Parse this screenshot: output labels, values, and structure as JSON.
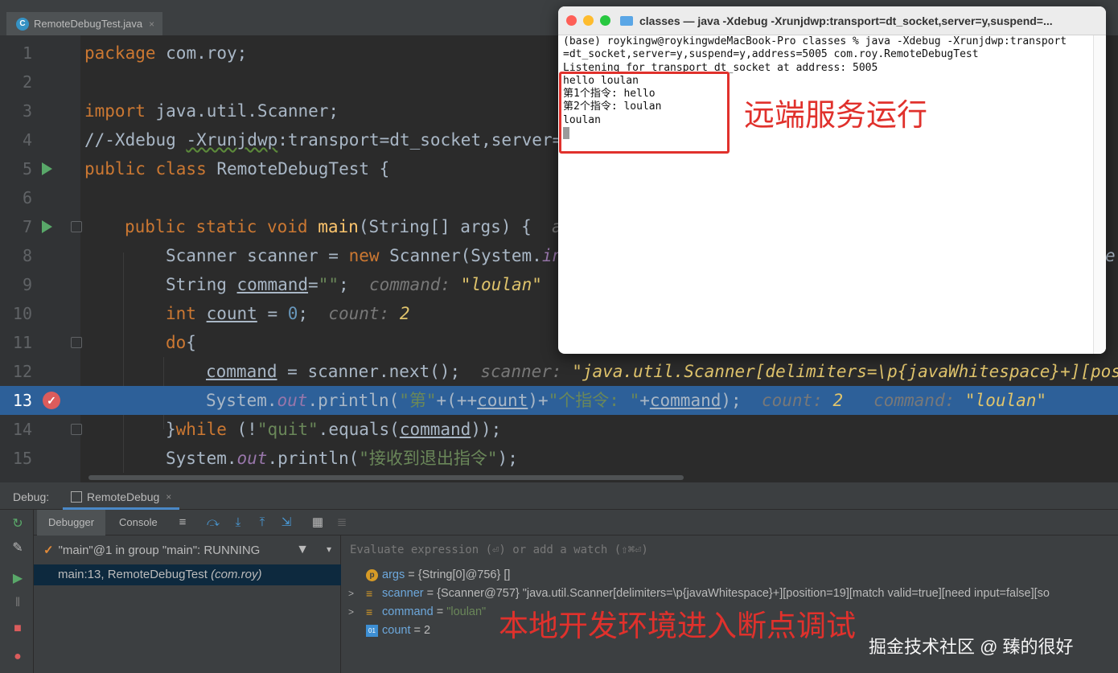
{
  "editor_tab": {
    "filename": "RemoteDebugTest.java",
    "icon": "C",
    "close": "×"
  },
  "code": {
    "l1": {
      "num": "1",
      "kw": "package",
      "rest": " com.roy;"
    },
    "l2": {
      "num": "2"
    },
    "l3": {
      "num": "3",
      "kw": "import",
      "rest": " java.util.Scanner;"
    },
    "l4": {
      "num": "4",
      "a": "//-Xdebug ",
      "b": "-Xrunjdwp",
      "c": ":transport=dt_socket,server="
    },
    "l5": {
      "num": "5",
      "kw": "public class",
      "rest": " RemoteDebugTest {"
    },
    "l6": {
      "num": "6"
    },
    "l7": {
      "num": "7",
      "kw": "public static void",
      "fn": "main",
      "rest": "(String[] args) {",
      "hint": "a"
    },
    "l8": {
      "num": "8",
      "a": "Scanner scanner = ",
      "kw": "new",
      "b": " Scanner(System.",
      "c": "in",
      "tail": "e"
    },
    "l9": {
      "num": "9",
      "a": "String ",
      "b": "command",
      "c": "=",
      "str": "\"\"",
      "d": ";",
      "hint": "command:",
      "hintv": "\"loulan\""
    },
    "l10": {
      "num": "10",
      "kw": "int",
      "b": "count",
      "c": " = ",
      "n": "0",
      "d": ";",
      "hint": "count:",
      "hintv": "2"
    },
    "l11": {
      "num": "11",
      "kw": "do",
      "rest": "{"
    },
    "l12": {
      "num": "12",
      "b": "command",
      "c": " = scanner.next();",
      "hint": "scanner:",
      "hintv": "\"java.util.Scanner[delimiters=\\p{javaWhitespace}+][pos"
    },
    "l13": {
      "num": "13",
      "a": "System.",
      "out": "out",
      "b": ".println(",
      "s1": "\"第\"",
      "c": "+(++",
      "cnt": "count",
      "d": ")+",
      "s2": "\"个指令: \"",
      "e": "+",
      "cmd": "command",
      "f": ");",
      "h1": "count:",
      "v1": "2",
      "h2": "command:",
      "v2": "\"loulan\""
    },
    "l14": {
      "num": "14",
      "a": "}",
      "kw": "while",
      "b": " (!",
      "str": "\"quit\"",
      "c": ".equals(",
      "cmd": "command",
      "d": "));"
    },
    "l15": {
      "num": "15",
      "a": "System.",
      "out": "out",
      "b": ".println(",
      "str": "\"接收到退出指令\"",
      "c": ");"
    }
  },
  "terminal": {
    "title": "classes — java -Xdebug -Xrunjdwp:transport=dt_socket,server=y,suspend=...",
    "lines": [
      "(base) roykingw@roykingwdeMacBook-Pro classes % java -Xdebug -Xrunjdwp:transport",
      "=dt_socket,server=y,suspend=y,address=5005 com.roy.RemoteDebugTest",
      "Listening for transport dt_socket at address: 5005",
      "hello loulan",
      "第1个指令: hello",
      "第2个指令: loulan",
      "loulan"
    ]
  },
  "annotations": {
    "remote": "远端服务运行",
    "local": "本地开发环境进入断点调试"
  },
  "debug": {
    "label": "Debug:",
    "tab": "RemoteDebug",
    "tab_close": "×",
    "subtabs": [
      "Debugger",
      "Console"
    ],
    "thread": "\"main\"@1 in group \"main\": RUNNING",
    "frame": "main:13, RemoteDebugTest",
    "frame_pkg": "(com.roy)",
    "watch_placeholder": "Evaluate expression (⏎) or add a watch (⇧⌘⏎)",
    "vars": [
      {
        "name": "args",
        "value": " = {String[0]@756} []"
      },
      {
        "name": "scanner",
        "value": " = {Scanner@757} \"java.util.Scanner[delimiters=\\p{javaWhitespace}+][position=19][match valid=true][need input=false][so"
      },
      {
        "name": "command",
        "eq": " = ",
        "value": "\"loulan\""
      },
      {
        "name": "count",
        "value": " = 2"
      }
    ],
    "var_icons": [
      "p",
      "f",
      "f",
      "01"
    ]
  },
  "watermark": "掘金技术社区 @ 臻的很好",
  "colors": {
    "keyword": "#cc7832",
    "string": "#6a8759",
    "current_line": "#2d6099",
    "annotation_red": "#e0312c"
  }
}
